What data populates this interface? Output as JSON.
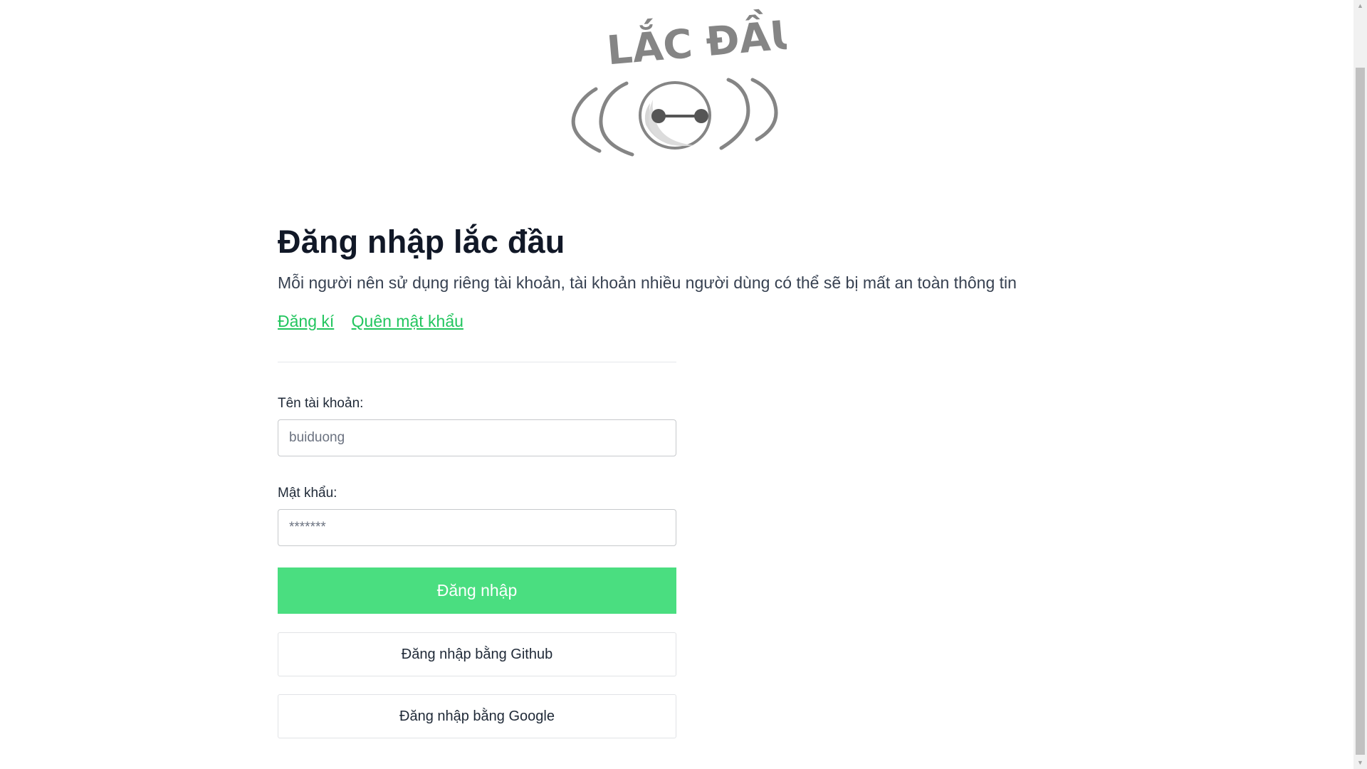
{
  "logo": {
    "text": "LẮC ĐẦU",
    "icon": "robot-face-shaking-icon"
  },
  "login": {
    "title": "Đăng nhập lắc đầu",
    "subtitle": "Mỗi người nên sử dụng riêng tài khoản, tài khoản nhiều người dùng có thể sẽ bị mất an toàn thông tin",
    "links": {
      "register": "Đăng kí",
      "forgot_password": "Quên mật khẩu"
    },
    "username": {
      "label": "Tên tài khoản:",
      "placeholder": "buiduong"
    },
    "password": {
      "label": "Mật khẩu:",
      "placeholder": "*******"
    },
    "submit_label": "Đăng nhập",
    "github_label": "Đăng nhập bằng Github",
    "google_label": "Đăng nhập bằng Google"
  },
  "scrollbar": {
    "up_icon": "triangle-up-icon",
    "down_icon": "triangle-down-icon",
    "up_glyph": "▲",
    "down_glyph": "▼"
  },
  "colors": {
    "accent": "#4ade80",
    "link": "#22c55e",
    "logo": "#858585"
  }
}
